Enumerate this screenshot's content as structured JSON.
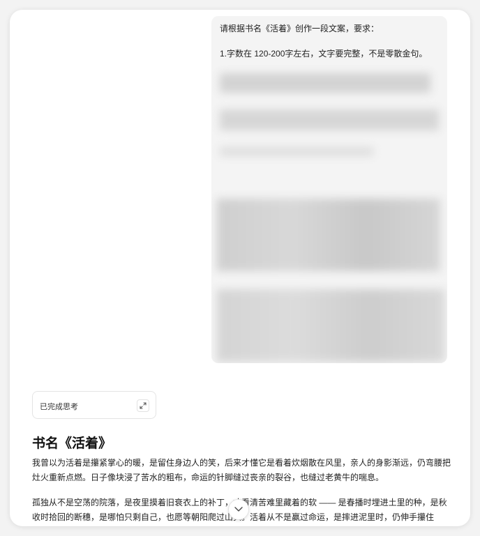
{
  "user_message": {
    "line1": "请根据书名《活着》创作一段文案，要求：",
    "line2": "1.字数在 120-200字左右，文字要完整，不是零散金句。"
  },
  "thinking": {
    "label": "已完成思考",
    "expand_icon": "expand-icon"
  },
  "answer": {
    "title": "书名《活着》",
    "paragraph1": "我曾以为活着是攥紧掌心的暖，是留住身边人的笑，后来才懂它是看着炊烟散在风里，亲人的身影渐远，仍弯腰把灶火重新点燃。日子像块浸了苦水的粗布，命运的针脚缝过丧亲的裂谷，也缝过老黄牛的喘息。",
    "paragraph2": "孤独从不是空荡的院落，是夜里摸着旧衰衣上的补丁，才看清苦难里藏着的软 —— 是春播时埋进土里的种，是秋收时拾回的断穗，是哪怕只剩自己，也愿等朝阳爬过山头。活着从不是赢过命运，是摔进泥里时，仍伸手攥住"
  },
  "scroll_down_icon": "chevron-down-icon"
}
